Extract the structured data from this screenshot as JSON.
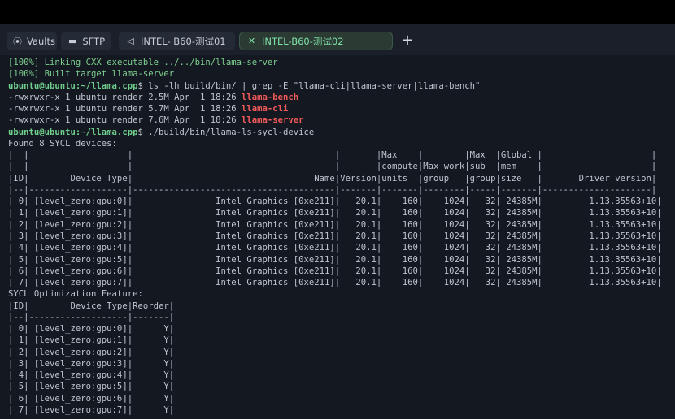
{
  "tabs": [
    {
      "icon": "vault-icon",
      "label": "Vaults"
    },
    {
      "icon": "folder-icon",
      "label": "SFTP"
    },
    {
      "icon": "terminal-icon",
      "label": "INTEL- B60-测试01"
    },
    {
      "icon": "close-icon",
      "label": "INTEL-B60-测试02",
      "active": true
    }
  ],
  "new_tab_label": "+",
  "terminal": {
    "lines": [
      [
        {
          "t": "[100%] ",
          "c": "g"
        },
        {
          "t": "Linking CXX executable ../../bin/llama-server",
          "c": "g"
        }
      ],
      [
        {
          "t": "[100%] Built target llama-server",
          "c": "g"
        }
      ],
      [
        {
          "t": "ubuntu@ubuntu:~/llama.cpp",
          "c": "prompt"
        },
        {
          "t": "$ ls -lh build/bin/ | grep -E \"llama-cli|llama-server|llama-bench\""
        }
      ],
      [
        {
          "t": "-rwxrwxr-x 1 ubuntu render 2.5M Apr  1 18:26 "
        },
        {
          "t": "llama-bench",
          "c": "red"
        }
      ],
      [
        {
          "t": "-rwxrwxr-x 1 ubuntu render 5.7M Apr  1 18:26 "
        },
        {
          "t": "llama-cli",
          "c": "red"
        }
      ],
      [
        {
          "t": "-rwxrwxr-x 1 ubuntu render 7.6M Apr  1 18:26 "
        },
        {
          "t": "llama-server",
          "c": "red"
        }
      ],
      [
        {
          "t": "ubuntu@ubuntu:~/llama.cpp",
          "c": "prompt"
        },
        {
          "t": "$ ./build/bin/llama-ls-sycl-device"
        }
      ],
      [
        {
          "t": "Found 8 SYCL devices:"
        }
      ],
      [
        {
          "t": "|  |                   |                                       |       |Max    |        |Max  |Global |                     |"
        }
      ],
      [
        {
          "t": "|  |                   |                                       |       |compute|Max work|sub  |mem    |                     |"
        }
      ],
      [
        {
          "t": "|ID|        Device Type|                                   Name|Version|units  |group   |group|size   |       Driver version|"
        }
      ],
      [
        {
          "t": "|--|-------------------|---------------------------------------|-------|-------|--------|-----|-------|---------------------|"
        }
      ],
      [
        {
          "t": "| 0| [level_zero:gpu:0]|                Intel Graphics [0xe211]|   20.1|    160|    1024|   32| 24385M|         1.13.35563+10|"
        }
      ],
      [
        {
          "t": "| 1| [level_zero:gpu:1]|                Intel Graphics [0xe211]|   20.1|    160|    1024|   32| 24385M|         1.13.35563+10|"
        }
      ],
      [
        {
          "t": "| 2| [level_zero:gpu:2]|                Intel Graphics [0xe211]|   20.1|    160|    1024|   32| 24385M|         1.13.35563+10|"
        }
      ],
      [
        {
          "t": "| 3| [level_zero:gpu:3]|                Intel Graphics [0xe211]|   20.1|    160|    1024|   32| 24385M|         1.13.35563+10|"
        }
      ],
      [
        {
          "t": "| 4| [level_zero:gpu:4]|                Intel Graphics [0xe211]|   20.1|    160|    1024|   32| 24385M|         1.13.35563+10|"
        }
      ],
      [
        {
          "t": "| 5| [level_zero:gpu:5]|                Intel Graphics [0xe211]|   20.1|    160|    1024|   32| 24385M|         1.13.35563+10|"
        }
      ],
      [
        {
          "t": "| 6| [level_zero:gpu:6]|                Intel Graphics [0xe211]|   20.1|    160|    1024|   32| 24385M|         1.13.35563+10|"
        }
      ],
      [
        {
          "t": "| 7| [level_zero:gpu:7]|                Intel Graphics [0xe211]|   20.1|    160|    1024|   32| 24385M|         1.13.35563+10|"
        }
      ],
      [
        {
          "t": "SYCL Optimization Feature:"
        }
      ],
      [
        {
          "t": "|ID|        Device Type|Reorder|"
        }
      ],
      [
        {
          "t": "|--|-------------------|-------|"
        }
      ],
      [
        {
          "t": "| 0| [level_zero:gpu:0]|      Y|"
        }
      ],
      [
        {
          "t": "| 1| [level_zero:gpu:1]|      Y|"
        }
      ],
      [
        {
          "t": "| 2| [level_zero:gpu:2]|      Y|"
        }
      ],
      [
        {
          "t": "| 3| [level_zero:gpu:3]|      Y|"
        }
      ],
      [
        {
          "t": "| 4| [level_zero:gpu:4]|      Y|"
        }
      ],
      [
        {
          "t": "| 5| [level_zero:gpu:5]|      Y|"
        }
      ],
      [
        {
          "t": "| 6| [level_zero:gpu:6]|      Y|"
        }
      ],
      [
        {
          "t": "| 7| [level_zero:gpu:7]|      Y|"
        }
      ]
    ]
  },
  "colors": {
    "background": "#141821",
    "prompt": "#6fcf8c",
    "executable": "#f05a5a",
    "active_tab_text": "#7fe1a8"
  }
}
